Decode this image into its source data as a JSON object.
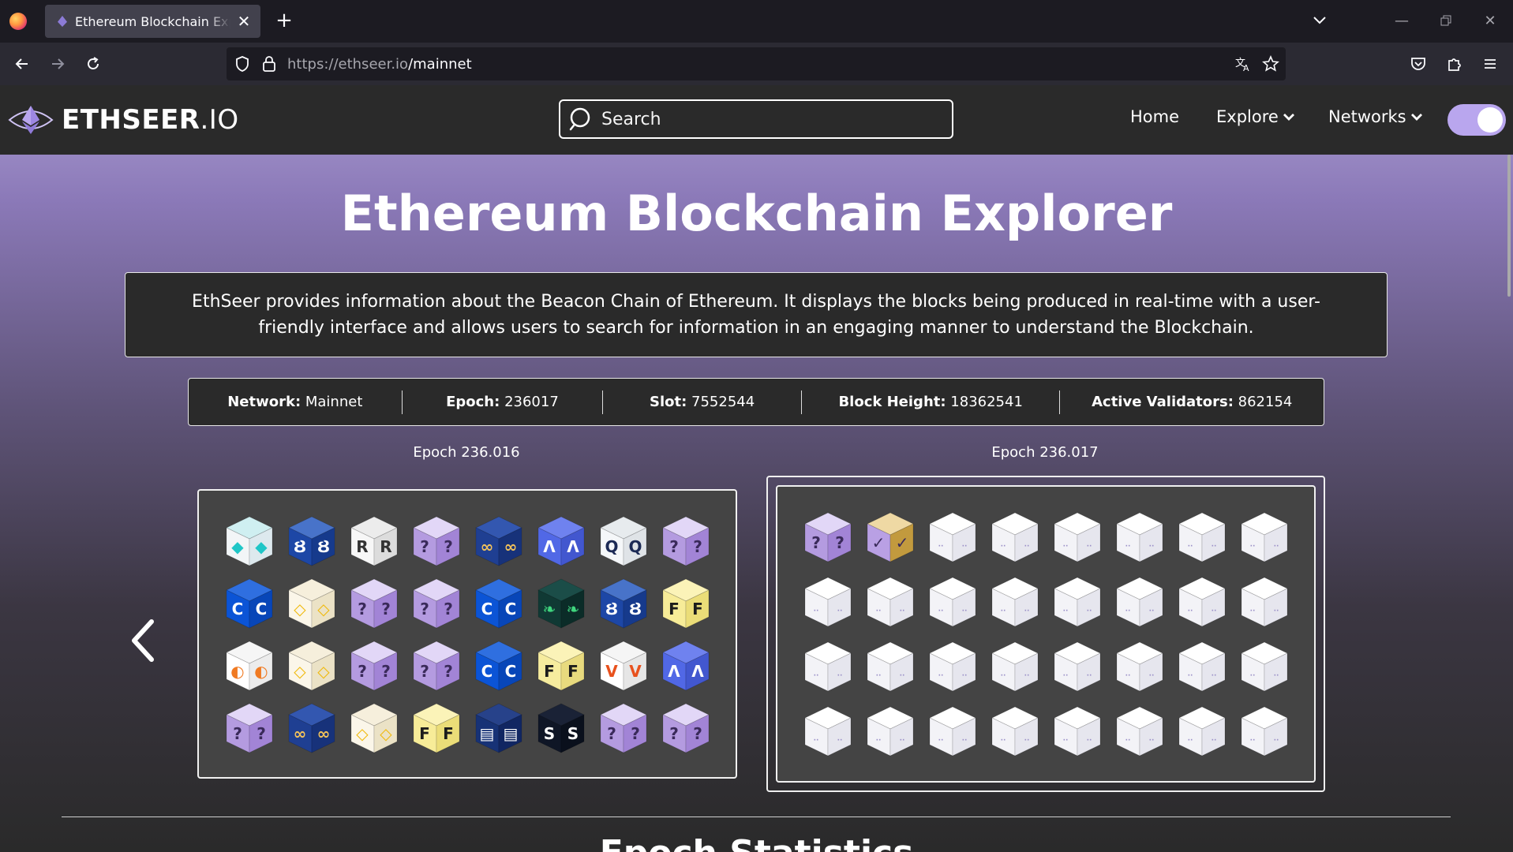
{
  "browser": {
    "tab_title": "Ethereum Blockchain Explorer - EthSeer",
    "url_domain": "https://ethseer.io",
    "url_path": "/mainnet"
  },
  "header": {
    "logo_main": "ETHSEER",
    "logo_suffix": ".IO",
    "search_placeholder": "Search",
    "nav": {
      "home": "Home",
      "explore": "Explore",
      "networks": "Networks"
    }
  },
  "hero": {
    "title": "Ethereum Blockchain Explorer",
    "description": "EthSeer provides information about the Beacon Chain of Ethereum. It displays the blocks being produced in real-time with a user-friendly interface and allows users to search for information in an engaging manner to understand the Blockchain."
  },
  "stats": [
    {
      "label": "Network:",
      "value": "Mainnet"
    },
    {
      "label": "Epoch:",
      "value": "236017"
    },
    {
      "label": "Slot:",
      "value": "7552544"
    },
    {
      "label": "Block Height:",
      "value": "18362541"
    },
    {
      "label": "Active Validators:",
      "value": "862154"
    }
  ],
  "epochs": [
    {
      "label": "Epoch 236.016",
      "blocks": [
        "lido",
        "rocketpool",
        "rocketx",
        "unknown",
        "stakefish",
        "kraken",
        "bitcoinsuisse",
        "unknown",
        "coinbase",
        "binance",
        "unknown",
        "unknown",
        "coinbase",
        "figment",
        "rocketpool",
        "fpool",
        "abyss",
        "binance",
        "unknown",
        "unknown",
        "coinbase",
        "fpool2",
        "ledger",
        "kraken",
        "unknown",
        "stakefish",
        "binance",
        "fpool",
        "wallet",
        "stakewise",
        "unknown",
        "unknown"
      ]
    },
    {
      "label": "Epoch 236.017",
      "blocks": [
        "unknown",
        "proposed",
        "pending",
        "pending",
        "pending",
        "pending",
        "pending",
        "pending",
        "pending",
        "pending",
        "pending",
        "pending",
        "pending",
        "pending",
        "pending",
        "pending",
        "pending",
        "pending",
        "pending",
        "pending",
        "pending",
        "pending",
        "pending",
        "pending",
        "pending",
        "pending",
        "pending",
        "pending",
        "pending",
        "pending",
        "pending",
        "pending"
      ]
    }
  ],
  "cube_themes": {
    "unknown": {
      "top": "#e2d7f7",
      "left": "#b49be0",
      "right": "#a284d6",
      "glyph": "?",
      "ink": "#3a2a5a"
    },
    "proposed": {
      "top": "#efd9a4",
      "left": "#b9a0e4",
      "right": "#c29a3e",
      "glyph": "✓",
      "ink": "#3a2a5a"
    },
    "pending": {
      "top": "#ffffff",
      "left": "#f3f3f7",
      "right": "#e6e6ee",
      "glyph": "··",
      "ink": "#9b90c8"
    },
    "lido": {
      "top": "#cfeff1",
      "left": "#f2f5f7",
      "right": "#dde9ee",
      "glyph": "◆",
      "ink": "#1fc6c7"
    },
    "rocketpool": {
      "top": "#4873c9",
      "left": "#1d47a6",
      "right": "#163a8c",
      "glyph": "Ȣ",
      "ink": "#ffffff"
    },
    "rocketx": {
      "top": "#ececec",
      "left": "#f7f7f7",
      "right": "#dcdcdc",
      "glyph": "R",
      "ink": "#333333"
    },
    "stakefish": {
      "top": "#3357b0",
      "left": "#1f3f92",
      "right": "#17327a",
      "glyph": "∞",
      "ink": "#f4c35a"
    },
    "kraken": {
      "top": "#6f82ef",
      "left": "#5168e6",
      "right": "#4257cf",
      "glyph": "Λ",
      "ink": "#ffffff"
    },
    "bitcoinsuisse": {
      "top": "#e7ebee",
      "left": "#f5f7f9",
      "right": "#dfe3e7",
      "glyph": "Q",
      "ink": "#1c2a55"
    },
    "coinbase": {
      "top": "#2f6fe0",
      "left": "#0b54d6",
      "right": "#0846b8",
      "glyph": "C",
      "ink": "#ffffff"
    },
    "binance": {
      "top": "#f6efdc",
      "left": "#fbf6e9",
      "right": "#ebe2c6",
      "glyph": "◇",
      "ink": "#f0b90b"
    },
    "figment": {
      "top": "#1b4d48",
      "left": "#103934",
      "right": "#0b2c28",
      "glyph": "❧",
      "ink": "#3fd67e"
    },
    "fpool": {
      "top": "#fbf3b8",
      "left": "#f7ec98",
      "right": "#ebdd78",
      "glyph": "F",
      "ink": "#1c1c1c"
    },
    "fpool2": {
      "top": "#fbf3b8",
      "left": "#f6ec9e",
      "right": "#e8da7e",
      "glyph": "F",
      "ink": "#1c1c1c"
    },
    "abyss": {
      "top": "#f6f6f6",
      "left": "#ffffff",
      "right": "#ececec",
      "glyph": "◐",
      "ink": "#f07a22"
    },
    "ledger": {
      "top": "#f5f5f5",
      "left": "#ffffff",
      "right": "#e6e6e6",
      "glyph": "V",
      "ink": "#e8511d"
    },
    "wallet": {
      "top": "#27428a",
      "left": "#173276",
      "right": "#112662",
      "glyph": "▤",
      "ink": "#ffffff"
    },
    "stakewise": {
      "top": "#1a2236",
      "left": "#0f1626",
      "right": "#0a101c",
      "glyph": "S",
      "ink": "#ffffff"
    }
  }
}
